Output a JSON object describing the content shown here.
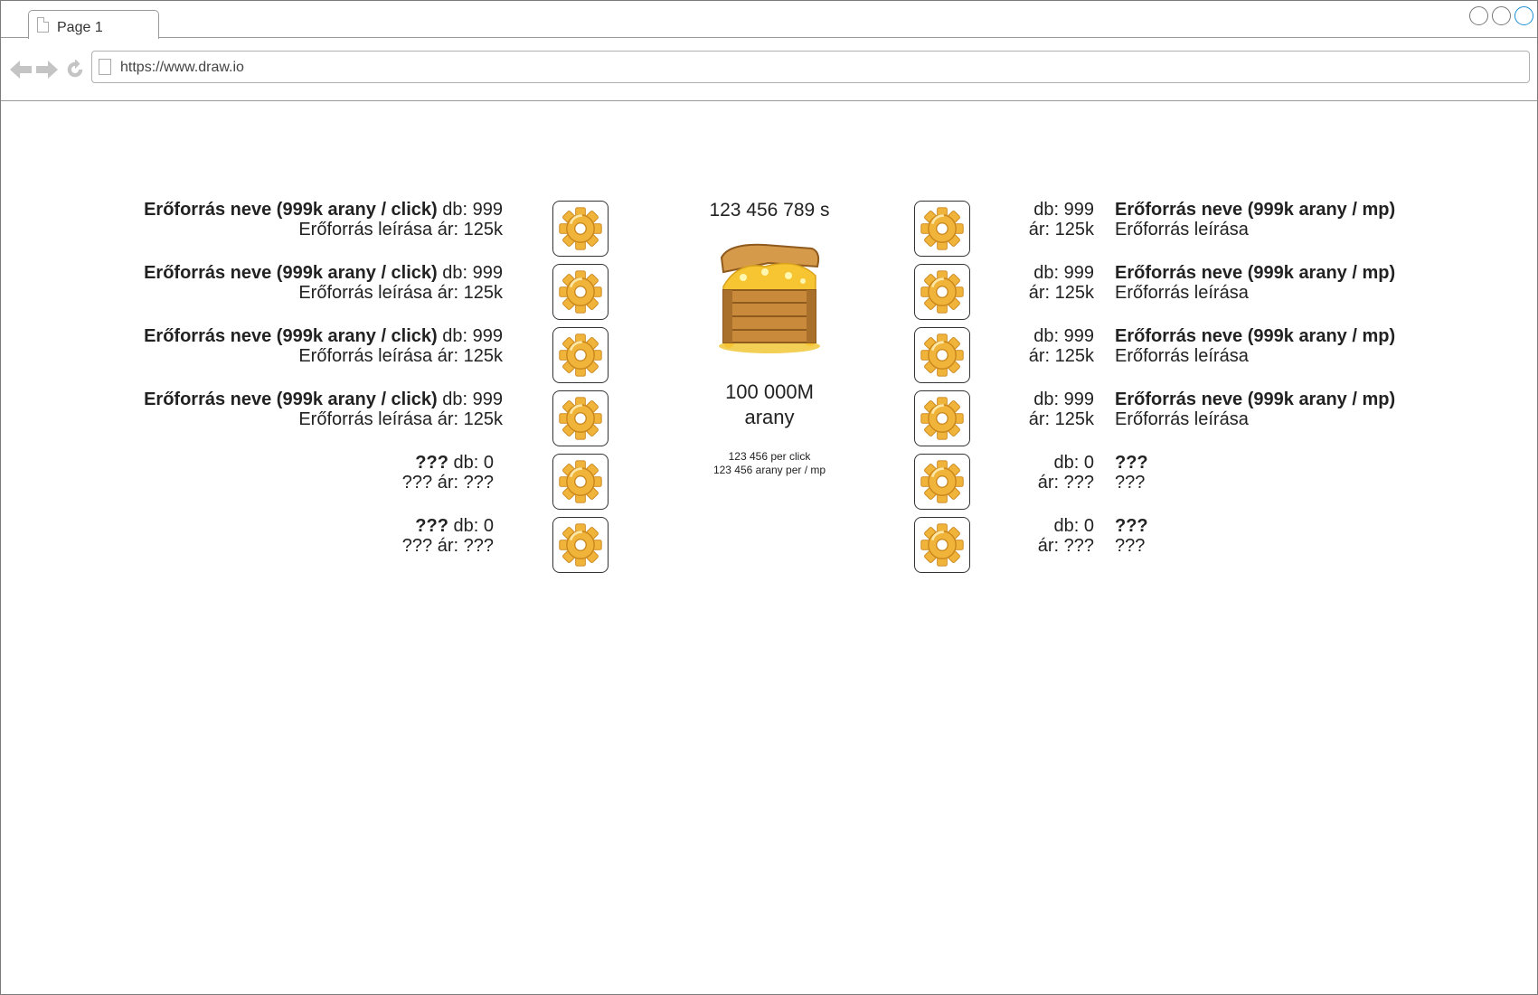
{
  "browser": {
    "tab_label": "Page 1",
    "url": "https://www.draw.io"
  },
  "center": {
    "timer": "123 456 789 s",
    "gold_amount": "100 000M",
    "gold_unit": "arany",
    "per_click": "123 456 per click",
    "per_second": "123 456 arany per / mp"
  },
  "left_items": [
    {
      "name": "Erőforrás neve (999k arany / click)",
      "desc": "Erőforrás leírása",
      "count": "db: 999",
      "price": "ár: 125k",
      "icon": "gear-icon"
    },
    {
      "name": "Erőforrás neve (999k arany / click)",
      "desc": "Erőforrás leírása",
      "count": "db: 999",
      "price": "ár: 125k",
      "icon": "gear-icon"
    },
    {
      "name": "Erőforrás neve (999k arany / click)",
      "desc": "Erőforrás leírása",
      "count": "db: 999",
      "price": "ár: 125k",
      "icon": "gear-icon"
    },
    {
      "name": "Erőforrás neve (999k arany / click)",
      "desc": "Erőforrás leírása",
      "count": "db: 999",
      "price": "ár: 125k",
      "icon": "gear-icon"
    },
    {
      "name": "???",
      "desc": "???",
      "count": "db: 0",
      "price": "ár: ???",
      "icon": "gear-icon"
    },
    {
      "name": "???",
      "desc": "???",
      "count": "db: 0",
      "price": "ár: ???",
      "icon": "gear-icon"
    }
  ],
  "right_items": [
    {
      "name": "Erőforrás neve (999k arany / mp)",
      "desc": "Erőforrás leírása",
      "count": "db: 999",
      "price": "ár: 125k",
      "icon": "gear-icon"
    },
    {
      "name": "Erőforrás neve (999k arany / mp)",
      "desc": "Erőforrás leírása",
      "count": "db: 999",
      "price": "ár: 125k",
      "icon": "gear-icon"
    },
    {
      "name": "Erőforrás neve (999k arany / mp)",
      "desc": "Erőforrás leírása",
      "count": "db: 999",
      "price": "ár: 125k",
      "icon": "gear-icon"
    },
    {
      "name": "Erőforrás neve (999k arany / mp)",
      "desc": "Erőforrás leírása",
      "count": "db: 999",
      "price": "ár: 125k",
      "icon": "gear-icon"
    },
    {
      "name": "???",
      "desc": "???",
      "count": "db: 0",
      "price": "ár: ???",
      "icon": "gear-icon"
    },
    {
      "name": "???",
      "desc": "???",
      "count": "db: 0",
      "price": "ár: ???",
      "icon": "gear-icon"
    }
  ],
  "colors": {
    "gear": "#f0b43a",
    "gear_dark": "#c9851a",
    "chest_wood": "#c98a3c",
    "gold": "#f7c531"
  }
}
